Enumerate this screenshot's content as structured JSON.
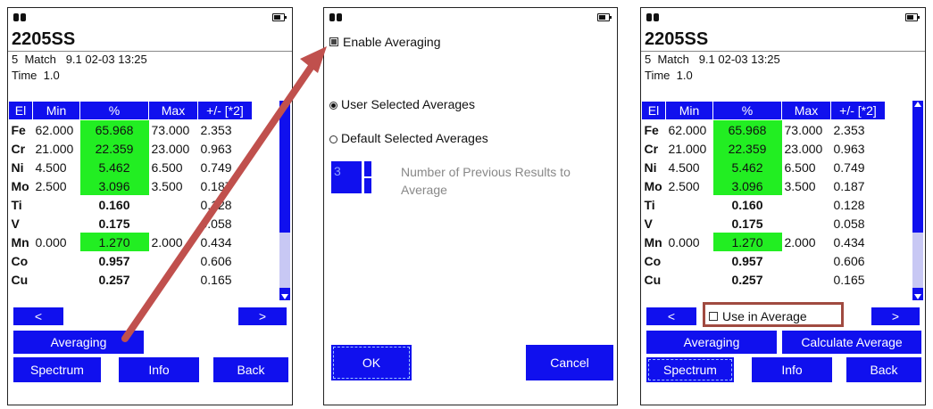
{
  "colors": {
    "button_blue": "#1010ee",
    "highlight_green": "#22ee22",
    "arrow_red": "#c0504d"
  },
  "icons": {
    "status_left": "binoculars-icon",
    "status_right": "battery-icon",
    "nav_prev": "<",
    "nav_next": ">"
  },
  "results": {
    "alloy": "2205SS",
    "match_line": "5  Match   9.1 02-03 13:25",
    "time_line": "Time  1.0",
    "headers": [
      "El",
      "Min",
      "%",
      "Max",
      "+/- [*2]"
    ],
    "rows": [
      {
        "el": "Fe",
        "min": "62.000",
        "pct": "65.968",
        "max": "73.000",
        "err": "2.353",
        "hl": true
      },
      {
        "el": "Cr",
        "min": "21.000",
        "pct": "22.359",
        "max": "23.000",
        "err": "0.963",
        "hl": true
      },
      {
        "el": "Ni",
        "min": "4.500",
        "pct": "5.462",
        "max": "6.500",
        "err": "0.749",
        "hl": true
      },
      {
        "el": "Mo",
        "min": "2.500",
        "pct": "3.096",
        "max": "3.500",
        "err": "0.187",
        "hl": true
      },
      {
        "el": "Ti",
        "min": "",
        "pct": "0.160",
        "max": "",
        "err": "0.128",
        "hl": false
      },
      {
        "el": "V",
        "min": "",
        "pct": "0.175",
        "max": "",
        "err": "0.058",
        "hl": false
      },
      {
        "el": "Mn",
        "min": "0.000",
        "pct": "1.270",
        "max": "2.000",
        "err": "0.434",
        "hl": true
      },
      {
        "el": "Co",
        "min": "",
        "pct": "0.957",
        "max": "",
        "err": "0.606",
        "hl": false
      },
      {
        "el": "Cu",
        "min": "",
        "pct": "0.257",
        "max": "",
        "err": "0.165",
        "hl": false
      }
    ],
    "buttons": {
      "averaging": "Averaging",
      "calculate_average": "Calculate Average",
      "spectrum": "Spectrum",
      "info": "Info",
      "back": "Back"
    },
    "use_in_average": "Use in Average"
  },
  "averaging_dialog": {
    "enable_averaging": "Enable Averaging",
    "user_selected": "User Selected Averages",
    "default_selected": "Default Selected Averages",
    "stepper_value": "3",
    "stepper_label": "Number of Previous Results to Average",
    "ok": "OK",
    "cancel": "Cancel"
  }
}
